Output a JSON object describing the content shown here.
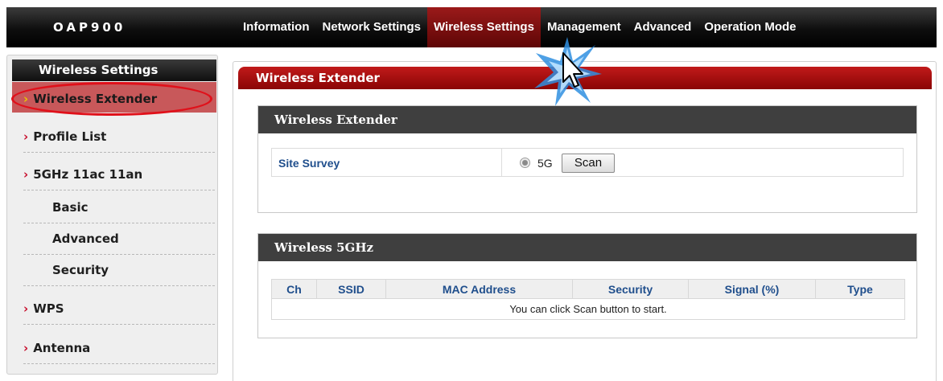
{
  "brand": "OAP900",
  "nav": [
    {
      "label": "Information",
      "active": false
    },
    {
      "label": "Network Settings",
      "active": false
    },
    {
      "label": "Wireless Settings",
      "active": true
    },
    {
      "label": "Management",
      "active": false
    },
    {
      "label": "Advanced",
      "active": false
    },
    {
      "label": "Operation Mode",
      "active": false
    }
  ],
  "sidebar": {
    "title": "Wireless Settings",
    "items": [
      {
        "label": "Wireless Extender"
      },
      {
        "label": "Profile List"
      },
      {
        "label": "5GHz 11ac 11an"
      },
      {
        "label": "Basic"
      },
      {
        "label": "Advanced"
      },
      {
        "label": "Security"
      },
      {
        "label": "WPS"
      },
      {
        "label": "Antenna"
      }
    ]
  },
  "main": {
    "title": "Wireless Extender",
    "extender_box": {
      "title": "Wireless Extender",
      "site_survey_label": "Site Survey",
      "band_label": "5G",
      "scan_label": "Scan"
    },
    "wireless_box": {
      "title": "Wireless 5GHz",
      "columns": [
        "Ch",
        "SSID",
        "MAC Address",
        "Security",
        "Signal (%)",
        "Type"
      ],
      "empty_message": "You can click Scan button to start."
    }
  },
  "colors": {
    "accent_red": "#a30f0f",
    "header_dark": "#3f3f3f",
    "label_blue": "#1f4e8c"
  }
}
